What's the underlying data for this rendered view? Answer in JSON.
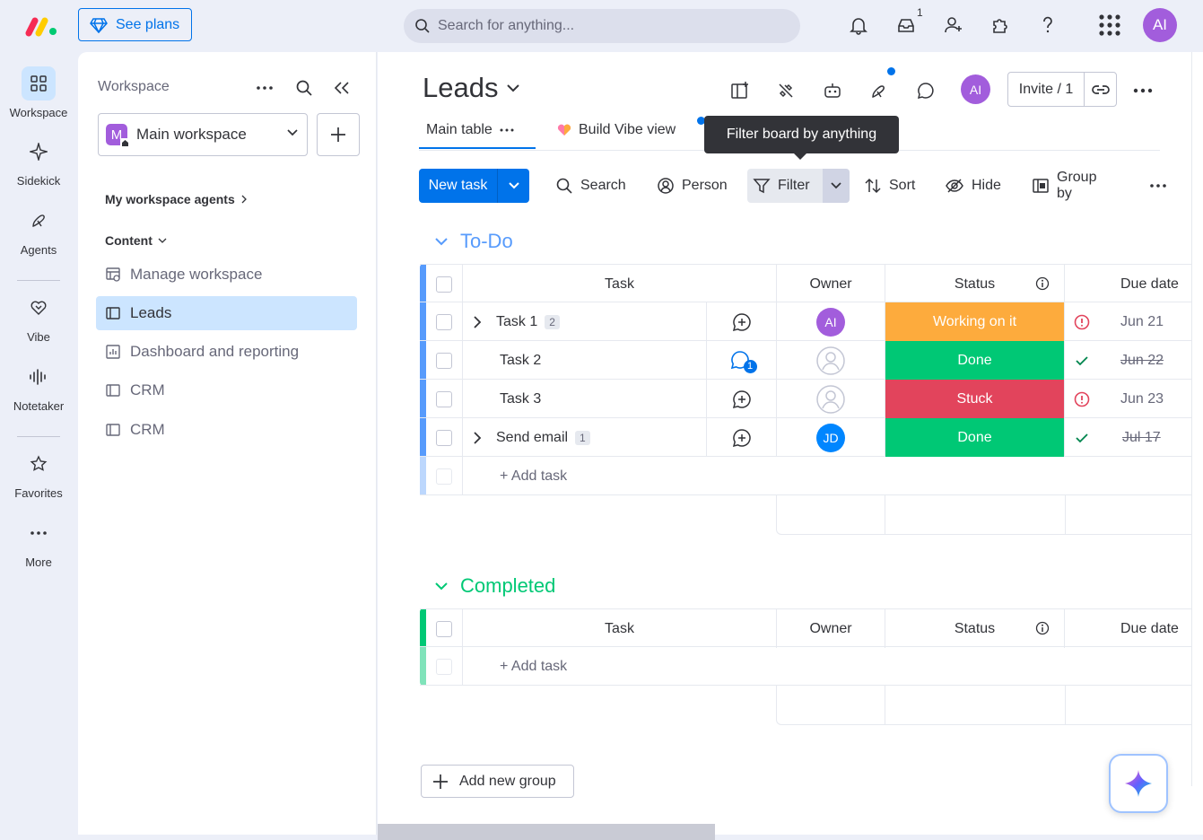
{
  "topbar": {
    "see_plans_label": "See plans",
    "search_placeholder": "Search for anything...",
    "inbox_count": "1",
    "user_initials": "AI"
  },
  "rail": {
    "items": [
      {
        "label": "Workspace",
        "icon": "grid-icon"
      },
      {
        "label": "Sidekick",
        "icon": "sparkle-icon"
      },
      {
        "label": "Agents",
        "icon": "agents-icon"
      },
      {
        "label": "Vibe",
        "icon": "heart-icon"
      },
      {
        "label": "Notetaker",
        "icon": "waveform-icon"
      },
      {
        "label": "Favorites",
        "icon": "star-icon"
      },
      {
        "label": "More",
        "icon": "more-dots-icon"
      }
    ]
  },
  "workspace_panel": {
    "title": "Workspace",
    "selected_workspace": "Main workspace",
    "workspace_badge": "M",
    "agents_section": "My workspace agents",
    "content_section": "Content",
    "items": [
      {
        "label": "Manage workspace",
        "icon": "manage-icon"
      },
      {
        "label": "Leads",
        "icon": "board-icon"
      },
      {
        "label": "Dashboard and reporting",
        "icon": "dashboard-icon"
      },
      {
        "label": "CRM",
        "icon": "board-icon"
      },
      {
        "label": "CRM",
        "icon": "board-icon"
      }
    ]
  },
  "board": {
    "title": "Leads",
    "user_initials": "AI",
    "invite_label": "Invite / 1",
    "tabs": [
      {
        "label": "Main table"
      },
      {
        "label": "Build Vibe view"
      }
    ],
    "tooltip": "Filter board by anything",
    "toolbar": {
      "new_task": "New task",
      "search": "Search",
      "person": "Person",
      "filter": "Filter",
      "sort": "Sort",
      "hide": "Hide",
      "group_by": "Group by"
    },
    "columns": {
      "task": "Task",
      "owner": "Owner",
      "status": "Status",
      "due_date": "Due date"
    },
    "groups": [
      {
        "title": "To-Do",
        "color": "#579bfc",
        "add_label": "+ Add task",
        "rows": [
          {
            "task": "Task 1",
            "subitems": "2",
            "owner": "AI",
            "owner_color": "#a25ddc",
            "status": "Working on it",
            "status_color": "#fdab3d",
            "due": "Jun 21",
            "done": false,
            "alert": true
          },
          {
            "task": "Task 2",
            "subitems": "",
            "owner": "",
            "status": "Done",
            "status_color": "#00c875",
            "due": "Jun 22",
            "done": true,
            "updates": "1"
          },
          {
            "task": "Task 3",
            "subitems": "",
            "owner": "",
            "status": "Stuck",
            "status_color": "#e2445c",
            "due": "Jun 23",
            "done": false,
            "alert": true
          },
          {
            "task": "Send email",
            "subitems": "1",
            "owner": "JD",
            "owner_color": "#0086ff",
            "status": "Done",
            "status_color": "#00c875",
            "due": "Jul 17",
            "done": true
          }
        ]
      },
      {
        "title": "Completed",
        "color": "#00c875",
        "add_label": "+ Add task",
        "rows": []
      }
    ],
    "add_group_label": "Add new group"
  }
}
